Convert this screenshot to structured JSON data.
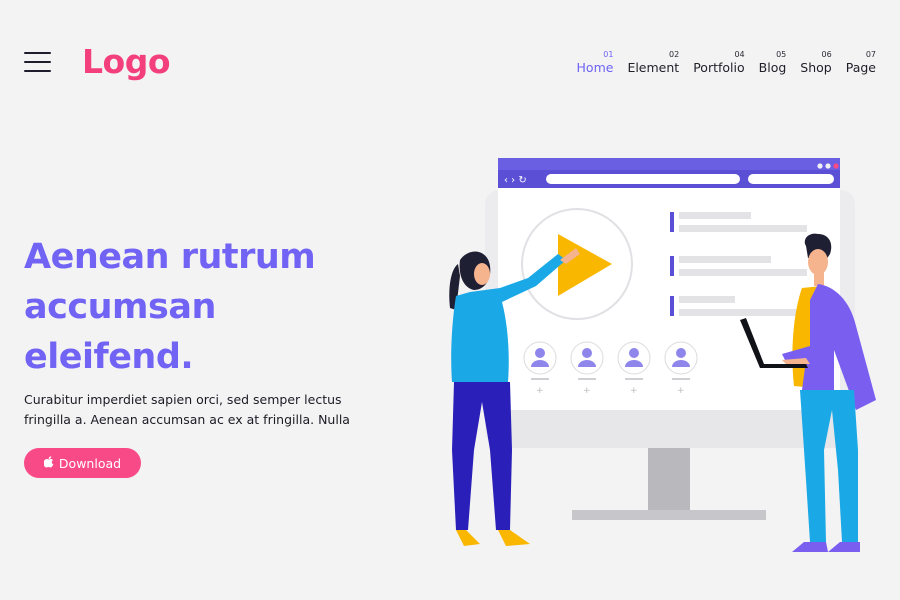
{
  "header": {
    "logo": "Logo",
    "nav": [
      {
        "num": "01",
        "label": "Home",
        "active": true
      },
      {
        "num": "02",
        "label": "Element",
        "active": false
      },
      {
        "num": "04",
        "label": "Portfolio",
        "active": false
      },
      {
        "num": "05",
        "label": "Blog",
        "active": false
      },
      {
        "num": "06",
        "label": "Shop",
        "active": false
      },
      {
        "num": "07",
        "label": "Page",
        "active": false
      }
    ]
  },
  "hero": {
    "title_lines": [
      "Aenean rutrum",
      "accumsan",
      "eleifend."
    ],
    "text_lines": [
      "Curabitur imperdiet sapien orci, sed semper lectus",
      "fringilla a. Aenean accumsan ac ex at fringilla. Nulla"
    ],
    "download_label": "Download",
    "download_icon": "apple-icon"
  },
  "colors": {
    "background": "#f4f3f4",
    "logo": "#f43f7d",
    "title": "#7163f3",
    "nav_active": "#6c63f5",
    "button": "#f84a86",
    "accent_purple": "#5b4fd6",
    "play_yellow": "#f9b700"
  }
}
